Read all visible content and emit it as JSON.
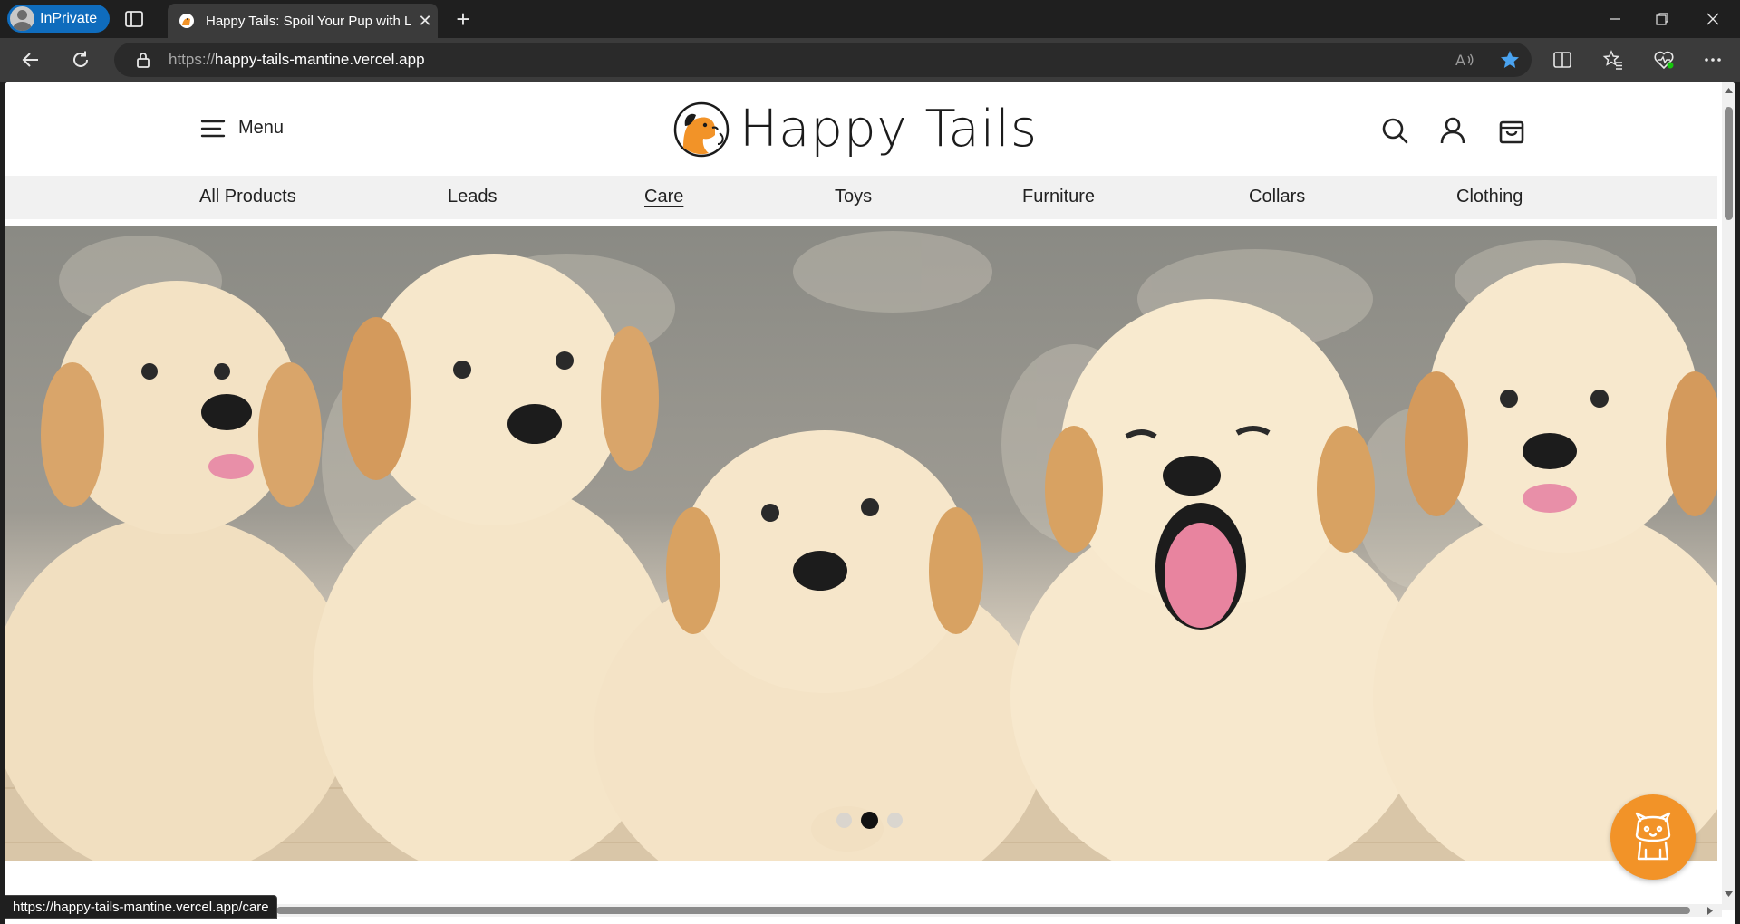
{
  "browser": {
    "inprivate_label": "InPrivate",
    "tab_title": "Happy Tails: Spoil Your Pup with L",
    "url_protocol": "https://",
    "url_host": "happy-tails-mantine.vercel.app",
    "status_url": "https://happy-tails-mantine.vercel.app/care"
  },
  "header": {
    "menu_label": "Menu",
    "logo_text": "Happy Tails"
  },
  "categories": [
    {
      "label": "All Products",
      "active": false
    },
    {
      "label": "Leads",
      "active": false
    },
    {
      "label": "Care",
      "active": true
    },
    {
      "label": "Toys",
      "active": false
    },
    {
      "label": "Furniture",
      "active": false
    },
    {
      "label": "Collars",
      "active": false
    },
    {
      "label": "Clothing",
      "active": false
    }
  ],
  "carousel": {
    "slide_count": 3,
    "active_index": 1
  },
  "colors": {
    "brand_orange": "#f29328",
    "nav_bg": "#f1f1f1",
    "inprivate_blue": "#0f6cbd"
  }
}
